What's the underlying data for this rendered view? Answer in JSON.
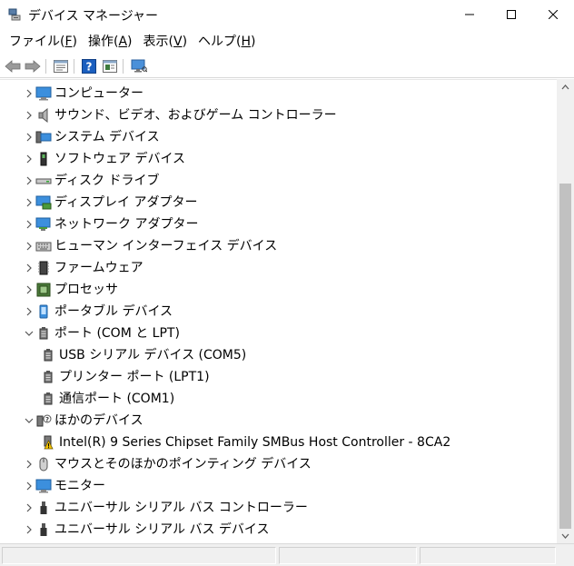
{
  "window": {
    "title": "デバイス マネージャー"
  },
  "menu": [
    {
      "label": "ファイル(",
      "mnemonic": "F",
      "suffix": ")"
    },
    {
      "label": "操作(",
      "mnemonic": "A",
      "suffix": ")"
    },
    {
      "label": "表示(",
      "mnemonic": "V",
      "suffix": ")"
    },
    {
      "label": "ヘルプ(",
      "mnemonic": "H",
      "suffix": ")"
    }
  ],
  "toolbar": [
    "back-icon",
    "forward-icon",
    "properties-icon",
    "help-icon",
    "show-hide-icon",
    "monitor-scan-icon"
  ],
  "tree": {
    "items": [
      {
        "label": "コンピューター",
        "icon": "computer-icon",
        "expanded": false
      },
      {
        "label": "サウンド、ビデオ、およびゲーム コントローラー",
        "icon": "speaker-icon",
        "expanded": false
      },
      {
        "label": "システム デバイス",
        "icon": "system-device-icon",
        "expanded": false
      },
      {
        "label": "ソフトウェア デバイス",
        "icon": "software-device-icon",
        "expanded": false
      },
      {
        "label": "ディスク ドライブ",
        "icon": "disk-drive-icon",
        "expanded": false
      },
      {
        "label": "ディスプレイ アダプター",
        "icon": "display-adapter-icon",
        "expanded": false
      },
      {
        "label": "ネットワーク アダプター",
        "icon": "network-adapter-icon",
        "expanded": false
      },
      {
        "label": "ヒューマン インターフェイス デバイス",
        "icon": "keyboard-icon",
        "expanded": false
      },
      {
        "label": "ファームウェア",
        "icon": "firmware-icon",
        "expanded": false
      },
      {
        "label": "プロセッサ",
        "icon": "processor-icon",
        "expanded": false
      },
      {
        "label": "ポータブル デバイス",
        "icon": "portable-device-icon",
        "expanded": false
      },
      {
        "label": "ポート (COM と LPT)",
        "icon": "port-icon",
        "expanded": true
      },
      {
        "label": "USB シリアル デバイス (COM5)",
        "icon": "port-icon",
        "child": true
      },
      {
        "label": "プリンター ポート (LPT1)",
        "icon": "port-icon",
        "child": true
      },
      {
        "label": "通信ポート (COM1)",
        "icon": "port-icon",
        "child": true
      },
      {
        "label": "ほかのデバイス",
        "icon": "unknown-device-icon",
        "expanded": true
      },
      {
        "label": "Intel(R) 9 Series Chipset Family SMBus Host Controller - 8CA2",
        "icon": "warning-device-icon",
        "child": true
      },
      {
        "label": "マウスとそのほかのポインティング デバイス",
        "icon": "mouse-icon",
        "expanded": false
      },
      {
        "label": "モニター",
        "icon": "monitor-icon",
        "expanded": false
      },
      {
        "label": "ユニバーサル シリアル バス コントローラー",
        "icon": "usb-icon",
        "expanded": false
      },
      {
        "label": "ユニバーサル シリアル バス デバイス",
        "icon": "usb-icon",
        "expanded": false
      }
    ]
  },
  "colors": {
    "accent": "#0078d7",
    "warning": "#f2c200"
  }
}
